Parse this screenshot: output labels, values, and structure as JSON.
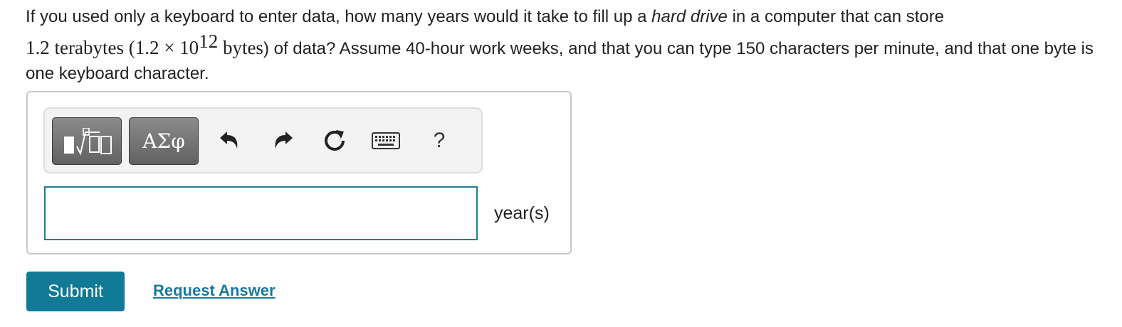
{
  "question": {
    "part1": "If you used only a keyboard to enter data, how many years would it take to fill up a ",
    "emphasis": "hard drive",
    "part2": " in a computer that can store",
    "math_value": "1.2 terabytes",
    "math_paren_open": " (",
    "math_mantissa": "1.2 × 10",
    "math_exponent": "12",
    "math_unit": " bytes",
    "part3": ") of data? Assume 40-hour work weeks, and that you can type 150 characters per minute, and that one byte is one keyboard character."
  },
  "toolbar": {
    "templates_icon": "templates-icon",
    "symbols_label": "ΑΣφ",
    "undo_icon": "undo-icon",
    "redo_icon": "redo-icon",
    "reset_icon": "reset-icon",
    "keyboard_icon": "keyboard-icon",
    "help_label": "?"
  },
  "answer": {
    "value": "",
    "unit": "year(s)"
  },
  "actions": {
    "submit_label": "Submit",
    "request_label": "Request Answer"
  },
  "colors": {
    "accent": "#117a96",
    "link": "#1778a0",
    "input_border": "#1e7c96"
  }
}
